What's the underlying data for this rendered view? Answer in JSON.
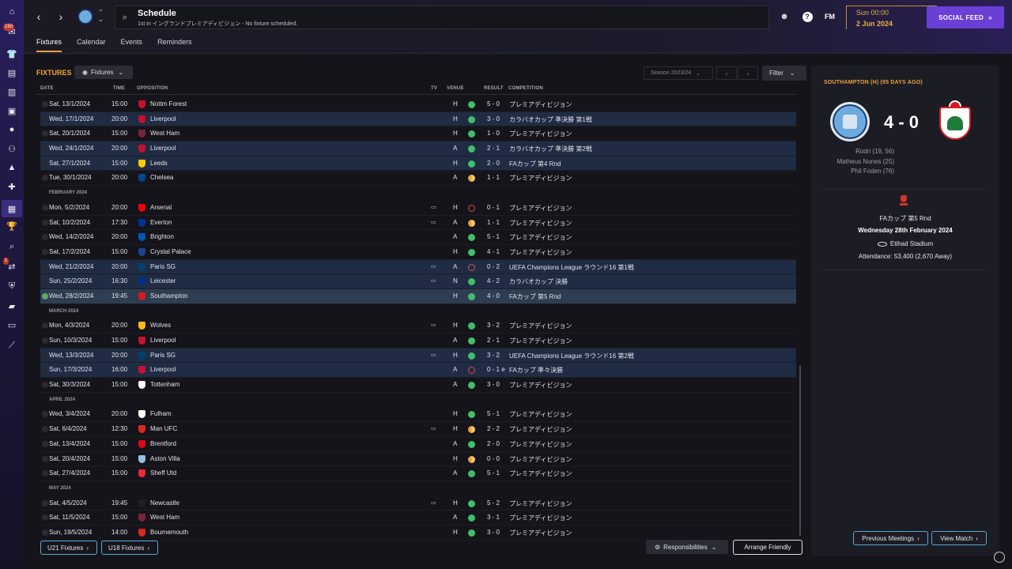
{
  "header": {
    "title": "Schedule",
    "subtitle": "1st in イングランドプレミアディビジョン - No fixture scheduled.",
    "time": "Sun 00:00",
    "date": "2 Jun 2024",
    "fm_logo": "FM",
    "social_feed_label": "SOCIAL FEED",
    "help_label": "?"
  },
  "tabs": [
    "Fixtures",
    "Calendar",
    "Events",
    "Reminders"
  ],
  "toolbar": {
    "section_title": "FIXTURES",
    "view_dropdown": "Fixtures",
    "season": "Season 2023/24",
    "filter": "Filter"
  },
  "columns": {
    "date": "DATE",
    "time": "TIME",
    "opposition": "OPPOSITION",
    "tv": "TV",
    "venue": "VENUE",
    "result": "RESULT",
    "competition": "COMPETITION"
  },
  "sections": [
    {
      "month": "",
      "rows": [
        {
          "date": "Sat, 13/1/2024",
          "time": "15:00",
          "opp": "Nottm Forest",
          "crest": "#c8102e",
          "tv": false,
          "venue": "H",
          "result": "win",
          "score": "5 - 0",
          "comp": "プレミアディビジョン",
          "hl": false
        },
        {
          "date": "Wed, 17/1/2024",
          "time": "20:00",
          "opp": "Liverpool",
          "crest": "#c8102e",
          "tv": false,
          "venue": "H",
          "result": "win",
          "score": "3 - 0",
          "comp": "カラバオカップ 準決勝 第1戦",
          "hl": true
        },
        {
          "date": "Sat, 20/1/2024",
          "time": "15:00",
          "opp": "West Ham",
          "crest": "#7a263a",
          "tv": false,
          "venue": "H",
          "result": "win",
          "score": "1 - 0",
          "comp": "プレミアディビジョン",
          "hl": false
        },
        {
          "date": "Wed, 24/1/2024",
          "time": "20:00",
          "opp": "Liverpool",
          "crest": "#c8102e",
          "tv": false,
          "venue": "A",
          "result": "win",
          "score": "2 - 1",
          "comp": "カラバオカップ 準決勝 第2戦",
          "hl": true
        },
        {
          "date": "Sat, 27/1/2024",
          "time": "15:00",
          "opp": "Leeds",
          "crest": "#ffcd00",
          "tv": false,
          "venue": "H",
          "result": "win",
          "score": "2 - 0",
          "comp": "FAカップ 第4 Rnd",
          "hl": true
        },
        {
          "date": "Tue, 30/1/2024",
          "time": "20:00",
          "opp": "Chelsea",
          "crest": "#034694",
          "tv": false,
          "venue": "A",
          "result": "draw",
          "score": "1 - 1",
          "comp": "プレミアディビジョン",
          "hl": false
        }
      ]
    },
    {
      "month": "FEBRUARY 2024",
      "rows": [
        {
          "date": "Mon, 5/2/2024",
          "time": "20:00",
          "opp": "Arsenal",
          "crest": "#ef0107",
          "tv": true,
          "venue": "H",
          "result": "loss",
          "score": "0 - 1",
          "comp": "プレミアディビジョン",
          "hl": false
        },
        {
          "date": "Sat, 10/2/2024",
          "time": "17:30",
          "opp": "Everton",
          "crest": "#003399",
          "tv": true,
          "venue": "A",
          "result": "draw",
          "score": "1 - 1",
          "comp": "プレミアディビジョン",
          "hl": false
        },
        {
          "date": "Wed, 14/2/2024",
          "time": "20:00",
          "opp": "Brighton",
          "crest": "#0057b8",
          "tv": false,
          "venue": "A",
          "result": "win",
          "score": "5 - 1",
          "comp": "プレミアディビジョン",
          "hl": false
        },
        {
          "date": "Sat, 17/2/2024",
          "time": "15:00",
          "opp": "Crystal Palace",
          "crest": "#1b458f",
          "tv": false,
          "venue": "H",
          "result": "win",
          "score": "4 - 1",
          "comp": "プレミアディビジョン",
          "hl": false
        },
        {
          "date": "Wed, 21/2/2024",
          "time": "20:00",
          "opp": "Paris SG",
          "crest": "#004170",
          "tv": true,
          "venue": "A",
          "result": "loss",
          "score": "0 - 2",
          "comp": "UEFA Champions League ラウンド16 第1戦",
          "hl": true
        },
        {
          "date": "Sun, 25/2/2024",
          "time": "16:30",
          "opp": "Leicester",
          "crest": "#003090",
          "tv": true,
          "venue": "N",
          "result": "win",
          "score": "4 - 2",
          "comp": "カラバオカップ 決勝",
          "hl": true
        },
        {
          "date": "Wed, 28/2/2024",
          "time": "19:45",
          "opp": "Southampton",
          "crest": "#d71920",
          "tv": false,
          "venue": "H",
          "result": "win",
          "score": "4 - 0",
          "comp": "FAカップ 第5 Rnd",
          "hl": true,
          "selected": true
        }
      ]
    },
    {
      "month": "MARCH 2024",
      "rows": [
        {
          "date": "Mon, 4/3/2024",
          "time": "20:00",
          "opp": "Wolves",
          "crest": "#fdb913",
          "tv": true,
          "venue": "H",
          "result": "win",
          "score": "3 - 2",
          "comp": "プレミアディビジョン",
          "hl": false
        },
        {
          "date": "Sun, 10/3/2024",
          "time": "15:00",
          "opp": "Liverpool",
          "crest": "#c8102e",
          "tv": false,
          "venue": "A",
          "result": "win",
          "score": "2 - 1",
          "comp": "プレミアディビジョン",
          "hl": false
        },
        {
          "date": "Wed, 13/3/2024",
          "time": "20:00",
          "opp": "Paris SG",
          "crest": "#004170",
          "tv": true,
          "venue": "H",
          "result": "win",
          "score": "3 - 2",
          "comp": "UEFA Champions League ラウンド16 第2戦",
          "hl": true
        },
        {
          "date": "Sun, 17/3/2024",
          "time": "16:00",
          "opp": "Liverpool",
          "crest": "#c8102e",
          "tv": false,
          "venue": "A",
          "result": "loss",
          "score": "0 - 1 e",
          "comp": "FAカップ 準々決勝",
          "hl": true
        },
        {
          "date": "Sat, 30/3/2024",
          "time": "15:00",
          "opp": "Tottenham",
          "crest": "#ffffff",
          "tv": false,
          "venue": "A",
          "result": "win",
          "score": "3 - 0",
          "comp": "プレミアディビジョン",
          "hl": false
        }
      ]
    },
    {
      "month": "APRIL 2024",
      "rows": [
        {
          "date": "Wed, 3/4/2024",
          "time": "20:00",
          "opp": "Fulham",
          "crest": "#ffffff",
          "tv": false,
          "venue": "H",
          "result": "win",
          "score": "5 - 1",
          "comp": "プレミアディビジョン",
          "hl": false
        },
        {
          "date": "Sat, 6/4/2024",
          "time": "12:30",
          "opp": "Man UFC",
          "crest": "#da291c",
          "tv": true,
          "venue": "H",
          "result": "draw",
          "score": "2 - 2",
          "comp": "プレミアディビジョン",
          "hl": false
        },
        {
          "date": "Sat, 13/4/2024",
          "time": "15:00",
          "opp": "Brentford",
          "crest": "#e30613",
          "tv": false,
          "venue": "A",
          "result": "win",
          "score": "2 - 0",
          "comp": "プレミアディビジョン",
          "hl": false
        },
        {
          "date": "Sat, 20/4/2024",
          "time": "15:00",
          "opp": "Aston Villa",
          "crest": "#95bfe5",
          "tv": false,
          "venue": "H",
          "result": "draw",
          "score": "0 - 0",
          "comp": "プレミアディビジョン",
          "hl": false
        },
        {
          "date": "Sat, 27/4/2024",
          "time": "15:00",
          "opp": "Sheff Utd",
          "crest": "#ee2737",
          "tv": false,
          "venue": "A",
          "result": "win",
          "score": "5 - 1",
          "comp": "プレミアディビジョン",
          "hl": false
        }
      ]
    },
    {
      "month": "MAY 2024",
      "rows": [
        {
          "date": "Sat, 4/5/2024",
          "time": "19:45",
          "opp": "Newcastle",
          "crest": "#241f20",
          "tv": true,
          "venue": "H",
          "result": "win",
          "score": "5 - 2",
          "comp": "プレミアディビジョン",
          "hl": false
        },
        {
          "date": "Sat, 11/5/2024",
          "time": "15:00",
          "opp": "West Ham",
          "crest": "#7a263a",
          "tv": false,
          "venue": "A",
          "result": "win",
          "score": "3 - 1",
          "comp": "プレミアディビジョン",
          "hl": false
        },
        {
          "date": "Sun, 19/5/2024",
          "time": "14:00",
          "opp": "Bournemouth",
          "crest": "#da291c",
          "tv": false,
          "venue": "H",
          "result": "win",
          "score": "3 - 0",
          "comp": "プレミアディビジョン",
          "hl": false
        }
      ]
    }
  ],
  "bottom": {
    "u21": "U21 Fixtures",
    "u18": "U18 Fixtures",
    "responsibilities": "Responsibilities",
    "arrange_friendly": "Arrange Friendly"
  },
  "side": {
    "title": "SOUTHAMPTON (H) (95 DAYS AGO)",
    "score": "4 - 0",
    "scorers": [
      "Rodri (19, 56)",
      "Matheus Nunes (25)",
      "Phil Foden (76)"
    ],
    "competition": "FAカップ 第5 Rnd",
    "date": "Wednesday 28th February 2024",
    "venue": "Etihad Stadium",
    "attendance": "Attendance: 53,400 (2,670 Away)",
    "previous_meetings": "Previous Meetings",
    "view_match": "View Match"
  },
  "rail_badges": {
    "top": "150",
    "mid": "1"
  },
  "colors": {
    "accent": "#e9a23b",
    "win": "#3fbf6a",
    "loss": "#e04a4a",
    "draw": "#e8a53a",
    "social": "#6a3fd6"
  }
}
